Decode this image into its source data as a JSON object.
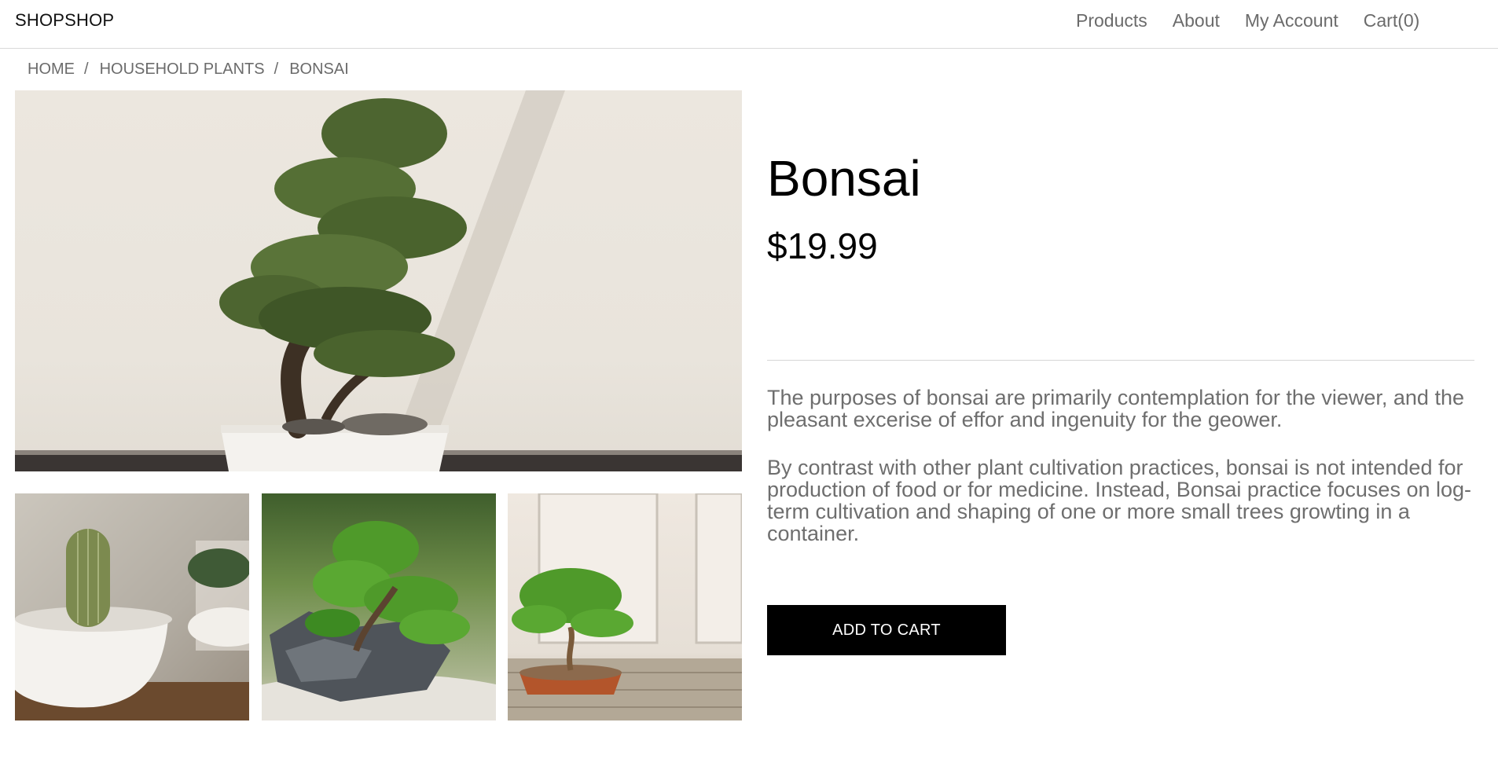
{
  "header": {
    "brand": "SHOPSHOP",
    "nav": {
      "products": "Products",
      "about": "About",
      "account": "My Account",
      "cart": "Cart(0)"
    }
  },
  "breadcrumb": {
    "home": "HOME",
    "category": "HOUSEHOLD PLANTS",
    "current": "BONSAI",
    "separator": "/"
  },
  "product": {
    "name": "Bonsai",
    "price": "$19.99",
    "description": [
      "The purposes of bonsai are primarily contemplation for the viewer, and the pleasant excerise of effor and ingenuity for the geower.",
      "By contrast with other plant cultivation practices, bonsai is not intended for production of food or for medicine. Instead, Bonsai practice focuses on log-term cultivation and shaping of one or more small trees growting in a container."
    ],
    "add_to_cart": "ADD TO CART"
  },
  "colors": {
    "button_bg": "#000000",
    "muted_text": "#6e6e6e",
    "divider": "#d6d6d6"
  }
}
